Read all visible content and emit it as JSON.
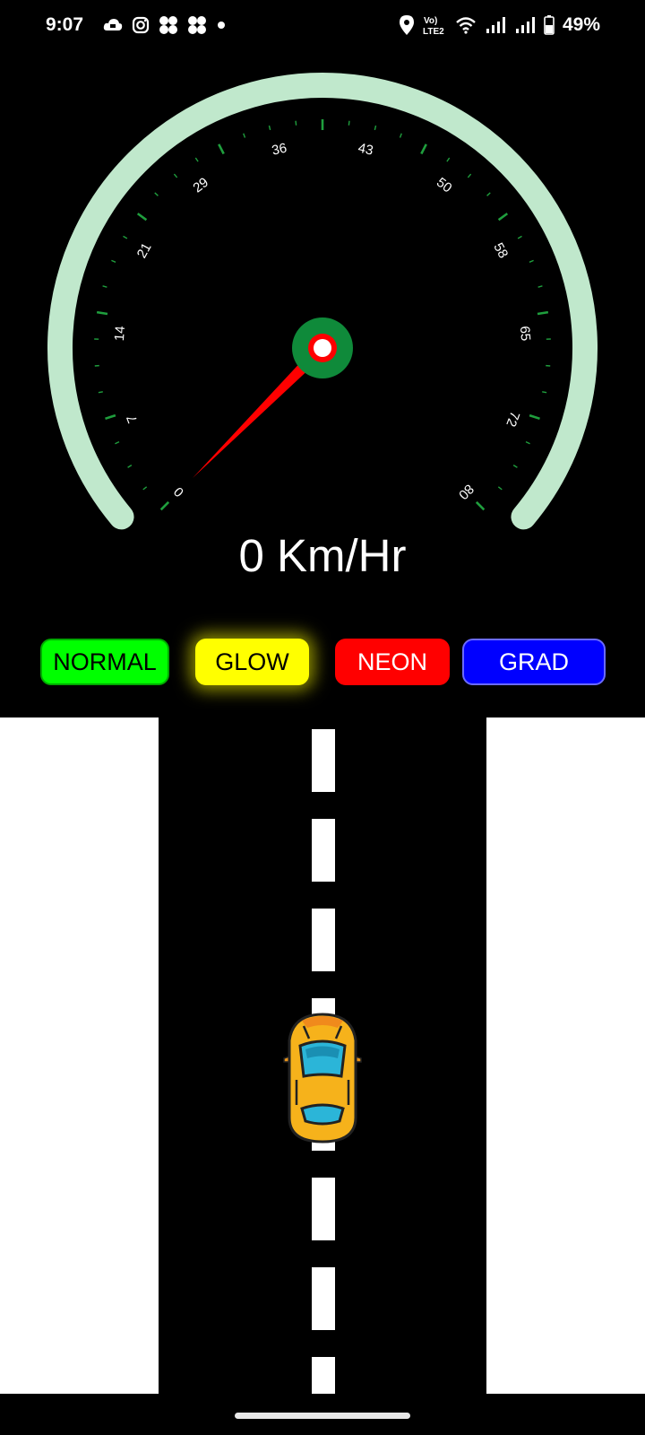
{
  "status_bar": {
    "time": "9:07",
    "battery": "49%",
    "left_icons": [
      "cloud-app-icon",
      "instagram-icon",
      "fan-icon",
      "fan-icon",
      "dot-icon"
    ],
    "right_icons": [
      "location-icon",
      "volte-lte2-icon",
      "wifi-icon",
      "signal-icon",
      "signal-icon",
      "battery-icon"
    ],
    "network_label_top": "Vo)",
    "network_label_bottom": "LTE2"
  },
  "speedometer": {
    "min": 0,
    "max": 80,
    "value": 0,
    "tick_labels": [
      "0",
      "7",
      "14",
      "21",
      "29",
      "36",
      "43",
      "50",
      "58",
      "65",
      "72",
      "80"
    ],
    "readout": "0 Km/Hr",
    "colors": {
      "arc": "#c0e8cc",
      "tick": "#1f9e3d",
      "needle": "#ff0000",
      "hub_outer": "#0f8a3a",
      "hub_inner": "#ff0000"
    }
  },
  "mode_buttons": {
    "normal": "NORMAL",
    "glow": "GLOW",
    "neon": "NEON",
    "grad": "GRAD"
  },
  "road": {
    "car_icon": "yellow-car-icon",
    "colors": {
      "road": "#000000",
      "lane": "#ffffff",
      "car_body": "#f6b21b",
      "car_glass": "#2bb5d8"
    }
  }
}
